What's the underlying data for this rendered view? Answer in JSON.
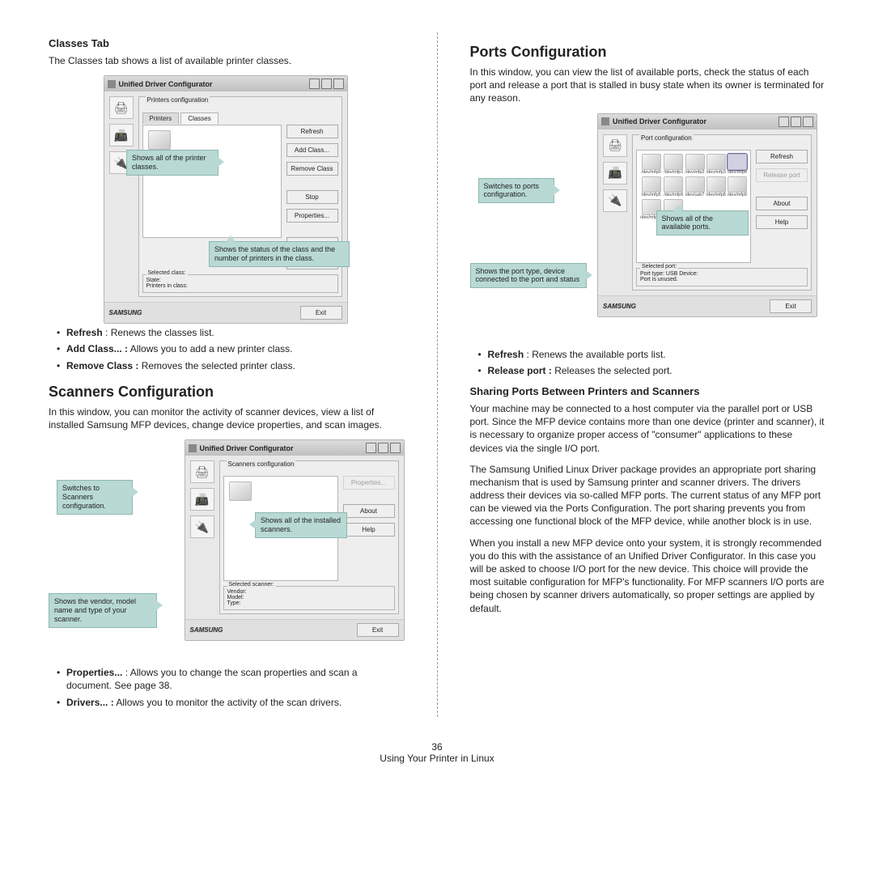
{
  "page": {
    "number": "36",
    "footer": "Using Your Printer in Linux"
  },
  "common": {
    "dialog_title": "Unified Driver Configurator",
    "logo": "SAMSUNG",
    "exit": "Exit"
  },
  "classes": {
    "heading": "Classes Tab",
    "intro": "The Classes tab shows a list of available printer classes.",
    "groupbox": "Printers configuration",
    "tab1": "Printers",
    "tab2": "Classes",
    "btns": {
      "refresh": "Refresh",
      "add": "Add Class...",
      "remove": "Remove Class",
      "stop": "Stop",
      "props": "Properties...",
      "about": "About",
      "help": "Help"
    },
    "sel_label": "Selected class:",
    "sel_state": "State:",
    "sel_count": "Printers in class:",
    "callout1": "Shows all of the printer classes.",
    "callout2": "Shows the status of the class and the number of printers in the class.",
    "bul1a": "Refresh",
    "bul1b": " : Renews the classes list.",
    "bul2a": "Add Class... :",
    "bul2b": " Allows you to add a new printer class.",
    "bul3a": "Remove Class :",
    "bul3b": " Removes the selected printer class."
  },
  "scanners": {
    "heading": "Scanners Configuration",
    "intro": "In this window, you can monitor the activity of scanner devices, view a list of installed Samsung MFP devices, change device properties, and scan images.",
    "groupbox": "Scanners configuration",
    "btns": {
      "props": "Properties...",
      "about": "About",
      "help": "Help"
    },
    "sel_label": "Selected scanner:",
    "sel_vendor": "Vendor:",
    "sel_model": "Model:",
    "sel_type": "Type:",
    "callout_switch": "Switches to Scanners configuration.",
    "callout_list": "Shows all of the installed scanners.",
    "callout_sel": "Shows the vendor, model name and type of your scanner.",
    "bul1a": "Properties...",
    "bul1b": " : Allows you to change the scan properties and scan a document. See page 38.",
    "bul2a": "Drivers... :",
    "bul2b": " Allows you to monitor the activity of the scan drivers."
  },
  "ports": {
    "heading": "Ports Configuration",
    "intro": "In this window, you can view the list of available ports, check the status of each port and release a port that is stalled in busy state when its owner is terminated for any reason.",
    "groupbox": "Port configuration",
    "btns": {
      "refresh": "Refresh",
      "release": "Release port",
      "about": "About",
      "help": "Help"
    },
    "port_labels": [
      "/dev/mfp0",
      "/dev/mfp1",
      "/dev/mfp2",
      "/dev/mfp3",
      "/dev/mfp4",
      "/dev/mfp5",
      "/dev/mfp6",
      "/dev/usb7",
      "/dev/mfp8",
      "/dev/mfp9",
      "/dev/mfp10",
      "/de"
    ],
    "sel_label": "Selected port:",
    "sel_type": "Port type: USB   Device:",
    "sel_status": "Port is unused.",
    "callout_switch": "Switches to ports configuration.",
    "callout_list": "Shows all of the available ports.",
    "callout_sel": "Shows the port type, device connected to the port and status",
    "bul1a": "Refresh",
    "bul1b": " : Renews the available ports list.",
    "bul2a": "Release port :",
    "bul2b": " Releases the selected port.",
    "share_heading": "Sharing Ports Between Printers and Scanners",
    "share_p1": "Your machine may be connected to a host computer via the parallel port or USB port. Since the MFP device contains more than one device (printer and scanner), it is necessary to organize proper access of \"consumer\" applications to these devices via the single I/O port.",
    "share_p2": "The Samsung Unified Linux Driver package provides an appropriate port sharing mechanism that is used by Samsung printer and scanner drivers. The drivers address their devices via so-called MFP ports. The current status of any MFP port can be viewed via the Ports Configuration. The port sharing prevents you from accessing one functional block of the MFP device, while another block is in use.",
    "share_p3": "When you install a new MFP device onto your system, it is strongly recommended you do this with the assistance of an Unified Driver Configurator. In this case you will be asked to choose I/O port for the new device. This choice will provide the most suitable configuration for MFP's functionality. For MFP scanners I/O ports are being chosen by scanner drivers automatically, so proper settings are applied by default."
  }
}
